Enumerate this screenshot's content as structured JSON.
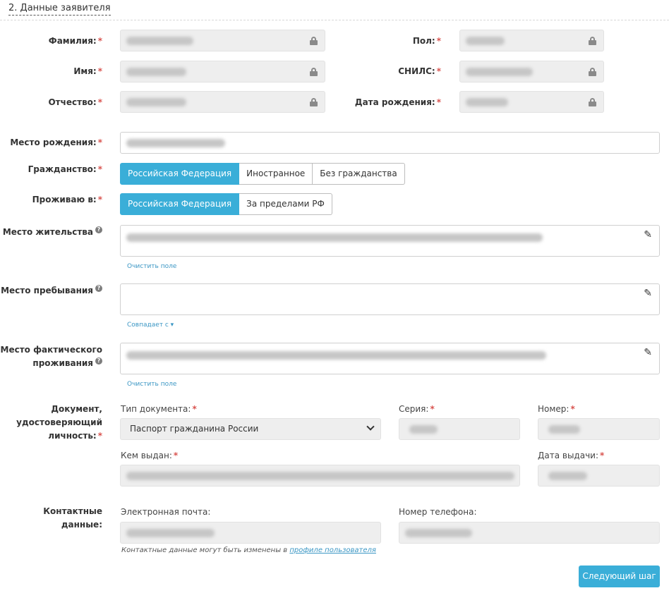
{
  "section": {
    "title": "2. Данные заявителя"
  },
  "required_mark": "*",
  "fields": {
    "lastname": "Фамилия:",
    "firstname": "Имя:",
    "patronymic": "Отчество:",
    "gender": "Пол:",
    "snils": "СНИЛС:",
    "birthdate": "Дата рождения:",
    "birthplace": "Место рождения:",
    "citizenship": "Гражданство:",
    "residing_in": "Проживаю в:",
    "residence": "Место жительства",
    "stay": "Место пребывания",
    "actual_line1": "Место фактического",
    "actual_line2": "проживания",
    "document_line1": "Документ,",
    "document_line2": "удостоверяющий",
    "document_line3": "личность:",
    "contacts": "Контактные данные:"
  },
  "citizenship_options": [
    "Российская Федерация",
    "Иностранное",
    "Без гражданства"
  ],
  "residing_options": [
    "Российская Федерация",
    "За пределами РФ"
  ],
  "links": {
    "clear_residence": "Очистить поле",
    "matches_with": "Совпадает с ▾",
    "clear_actual": "Очистить поле"
  },
  "document": {
    "type_label": "Тип документа:",
    "type_value": "Паспорт гражданина России",
    "series_label": "Серия:",
    "number_label": "Номер:",
    "issued_by_label": "Кем выдан:",
    "issue_date_label": "Дата выдачи:"
  },
  "contacts": {
    "email_label": "Электронная почта:",
    "phone_label": "Номер телефона:",
    "note_text": "Контактные данные могут быть изменены в ",
    "note_link": "профиле пользователя"
  },
  "next_button": "Следующий шаг",
  "icons": {
    "lock": "lock-icon",
    "pencil": "pencil-icon",
    "help": "question-icon",
    "chevron": "chevron-down-icon"
  },
  "colors": {
    "accent": "#3aaed8",
    "required": "#d9534f",
    "link": "#3a96c4",
    "readonly_bg": "#eeeeee"
  }
}
